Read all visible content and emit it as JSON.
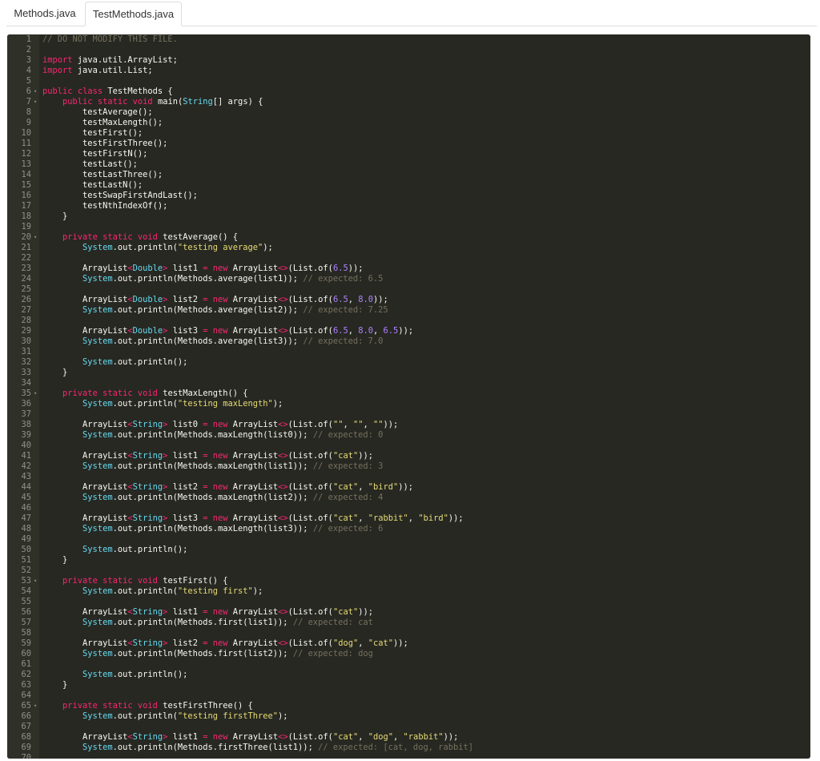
{
  "tabs": [
    {
      "label": "Methods.java"
    },
    {
      "label": "TestMethods.java"
    }
  ],
  "colors": {
    "editor_background": "#272822",
    "gutter_background": "#2f3129",
    "keyword": "#f92672",
    "type": "#66d9ef",
    "string": "#e6db74",
    "number": "#ae81ff",
    "comment": "#75715e",
    "default_text": "#f8f8f2"
  },
  "editor": {
    "fold_marker": "▾",
    "lines": [
      {
        "n": "1",
        "code": "// DO NOT MODIFY THIS FILE."
      },
      {
        "n": "2",
        "code": ""
      },
      {
        "n": "3",
        "code": "import java.util.ArrayList;"
      },
      {
        "n": "4",
        "code": "import java.util.List;"
      },
      {
        "n": "5",
        "code": ""
      },
      {
        "n": "6",
        "code": "public class TestMethods {",
        "fold": true
      },
      {
        "n": "7",
        "code": "    public static void main(String[] args) {",
        "fold": true
      },
      {
        "n": "8",
        "code": "        testAverage();"
      },
      {
        "n": "9",
        "code": "        testMaxLength();"
      },
      {
        "n": "10",
        "code": "        testFirst();"
      },
      {
        "n": "11",
        "code": "        testFirstThree();"
      },
      {
        "n": "12",
        "code": "        testFirstN();"
      },
      {
        "n": "13",
        "code": "        testLast();"
      },
      {
        "n": "14",
        "code": "        testLastThree();"
      },
      {
        "n": "15",
        "code": "        testLastN();"
      },
      {
        "n": "16",
        "code": "        testSwapFirstAndLast();"
      },
      {
        "n": "17",
        "code": "        testNthIndexOf();"
      },
      {
        "n": "18",
        "code": "    }"
      },
      {
        "n": "19",
        "code": ""
      },
      {
        "n": "20",
        "code": "    private static void testAverage() {",
        "fold": true
      },
      {
        "n": "21",
        "code": "        System.out.println(\"testing average\");"
      },
      {
        "n": "22",
        "code": ""
      },
      {
        "n": "23",
        "code": "        ArrayList<Double> list1 = new ArrayList<>(List.of(6.5));"
      },
      {
        "n": "24",
        "code": "        System.out.println(Methods.average(list1)); // expected: 6.5"
      },
      {
        "n": "25",
        "code": ""
      },
      {
        "n": "26",
        "code": "        ArrayList<Double> list2 = new ArrayList<>(List.of(6.5, 8.0));"
      },
      {
        "n": "27",
        "code": "        System.out.println(Methods.average(list2)); // expected: 7.25"
      },
      {
        "n": "28",
        "code": ""
      },
      {
        "n": "29",
        "code": "        ArrayList<Double> list3 = new ArrayList<>(List.of(6.5, 8.0, 6.5));"
      },
      {
        "n": "30",
        "code": "        System.out.println(Methods.average(list3)); // expected: 7.0"
      },
      {
        "n": "31",
        "code": ""
      },
      {
        "n": "32",
        "code": "        System.out.println();"
      },
      {
        "n": "33",
        "code": "    }"
      },
      {
        "n": "34",
        "code": ""
      },
      {
        "n": "35",
        "code": "    private static void testMaxLength() {",
        "fold": true
      },
      {
        "n": "36",
        "code": "        System.out.println(\"testing maxLength\");"
      },
      {
        "n": "37",
        "code": ""
      },
      {
        "n": "38",
        "code": "        ArrayList<String> list0 = new ArrayList<>(List.of(\"\", \"\", \"\"));"
      },
      {
        "n": "39",
        "code": "        System.out.println(Methods.maxLength(list0)); // expected: 0"
      },
      {
        "n": "40",
        "code": ""
      },
      {
        "n": "41",
        "code": "        ArrayList<String> list1 = new ArrayList<>(List.of(\"cat\"));"
      },
      {
        "n": "42",
        "code": "        System.out.println(Methods.maxLength(list1)); // expected: 3"
      },
      {
        "n": "43",
        "code": ""
      },
      {
        "n": "44",
        "code": "        ArrayList<String> list2 = new ArrayList<>(List.of(\"cat\", \"bird\"));"
      },
      {
        "n": "45",
        "code": "        System.out.println(Methods.maxLength(list2)); // expected: 4"
      },
      {
        "n": "46",
        "code": ""
      },
      {
        "n": "47",
        "code": "        ArrayList<String> list3 = new ArrayList<>(List.of(\"cat\", \"rabbit\", \"bird\"));"
      },
      {
        "n": "48",
        "code": "        System.out.println(Methods.maxLength(list3)); // expected: 6"
      },
      {
        "n": "49",
        "code": ""
      },
      {
        "n": "50",
        "code": "        System.out.println();"
      },
      {
        "n": "51",
        "code": "    }"
      },
      {
        "n": "52",
        "code": ""
      },
      {
        "n": "53",
        "code": "    private static void testFirst() {",
        "fold": true
      },
      {
        "n": "54",
        "code": "        System.out.println(\"testing first\");"
      },
      {
        "n": "55",
        "code": ""
      },
      {
        "n": "56",
        "code": "        ArrayList<String> list1 = new ArrayList<>(List.of(\"cat\"));"
      },
      {
        "n": "57",
        "code": "        System.out.println(Methods.first(list1)); // expected: cat"
      },
      {
        "n": "58",
        "code": ""
      },
      {
        "n": "59",
        "code": "        ArrayList<String> list2 = new ArrayList<>(List.of(\"dog\", \"cat\"));"
      },
      {
        "n": "60",
        "code": "        System.out.println(Methods.first(list2)); // expected: dog"
      },
      {
        "n": "61",
        "code": ""
      },
      {
        "n": "62",
        "code": "        System.out.println();"
      },
      {
        "n": "63",
        "code": "    }"
      },
      {
        "n": "64",
        "code": ""
      },
      {
        "n": "65",
        "code": "    private static void testFirstThree() {",
        "fold": true
      },
      {
        "n": "66",
        "code": "        System.out.println(\"testing firstThree\");"
      },
      {
        "n": "67",
        "code": ""
      },
      {
        "n": "68",
        "code": "        ArrayList<String> list1 = new ArrayList<>(List.of(\"cat\", \"dog\", \"rabbit\"));"
      },
      {
        "n": "69",
        "code": "        System.out.println(Methods.firstThree(list1)); // expected: [cat, dog, rabbit]"
      },
      {
        "n": "70",
        "code": ""
      }
    ]
  }
}
